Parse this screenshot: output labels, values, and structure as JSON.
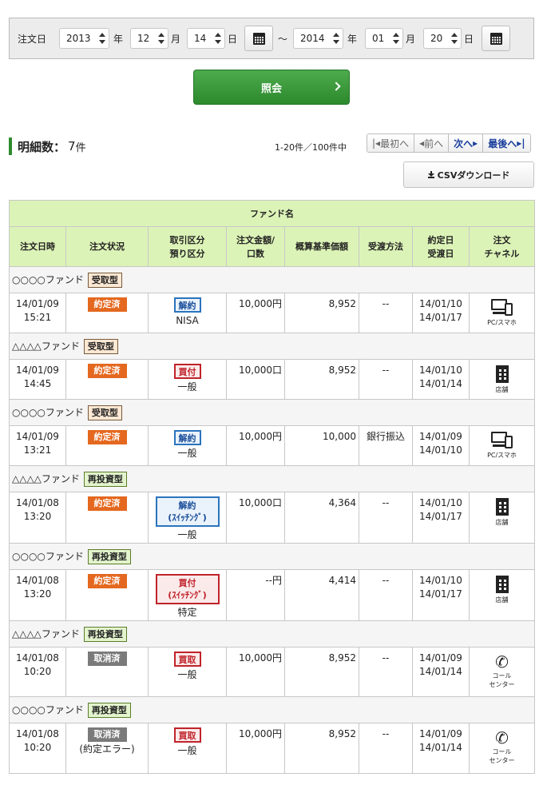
{
  "filter": {
    "label": "注文日",
    "from": {
      "year": "2013",
      "month": "12",
      "day": "14"
    },
    "to": {
      "year": "2014",
      "month": "01",
      "day": "20"
    },
    "year_unit": "年",
    "month_unit": "月",
    "day_unit": "日",
    "separator": "～"
  },
  "search_label": "照会",
  "count": {
    "label": "明細数：",
    "value": "7",
    "unit": "件"
  },
  "range_text": "1-20件／100件中",
  "pager": {
    "first": "最初へ",
    "prev": "前へ",
    "next": "次へ",
    "last": "最後へ"
  },
  "csv_label": "CSVダウンロード",
  "table": {
    "fund_header": "ファンド名",
    "headers": {
      "date": "注文日時",
      "status": "注文状況",
      "type_l1": "取引区分",
      "type_l2": "預り区分",
      "amount_l1": "注文金額/",
      "amount_l2": "口数",
      "price": "概算基準価額",
      "payment": "受渡方法",
      "dates_l1": "約定日",
      "dates_l2": "受渡日",
      "channel_l1": "注文",
      "channel_l2": "チャネル"
    },
    "orders": [
      {
        "fund": "○○○○ファンド",
        "fund_type": "受取型",
        "date": "14/01/09",
        "time": "15:21",
        "status": "約定済",
        "status_sub": "",
        "trade": "解約",
        "trade_sub": "",
        "account": "NISA",
        "amount": "10,000円",
        "price": "8,952",
        "payment": "--",
        "exec_date": "14/01/10",
        "settle_date": "14/01/17",
        "channel_l1": "PC/スマホ",
        "channel_l2": ""
      },
      {
        "fund": "△△△△ファンド",
        "fund_type": "受取型",
        "date": "14/01/09",
        "time": "14:45",
        "status": "約定済",
        "status_sub": "",
        "trade": "買付",
        "trade_sub": "",
        "account": "一般",
        "amount": "10,000口",
        "price": "8,952",
        "payment": "--",
        "exec_date": "14/01/10",
        "settle_date": "14/01/14",
        "channel_l1": "店舗",
        "channel_l2": ""
      },
      {
        "fund": "○○○○ファンド",
        "fund_type": "受取型",
        "date": "14/01/09",
        "time": "13:21",
        "status": "約定済",
        "status_sub": "",
        "trade": "解約",
        "trade_sub": "",
        "account": "一般",
        "amount": "10,000円",
        "price": "10,000",
        "payment": "銀行振込",
        "exec_date": "14/01/09",
        "settle_date": "14/01/10",
        "channel_l1": "PC/スマホ",
        "channel_l2": ""
      },
      {
        "fund": "△△△△ファンド",
        "fund_type": "再投資型",
        "date": "14/01/08",
        "time": "13:20",
        "status": "約定済",
        "status_sub": "",
        "trade": "解約",
        "trade_sub": "(ｽｲｯﾁﾝｸﾞ)",
        "account": "一般",
        "amount": "10,000口",
        "price": "4,364",
        "payment": "--",
        "exec_date": "14/01/10",
        "settle_date": "14/01/17",
        "channel_l1": "店舗",
        "channel_l2": ""
      },
      {
        "fund": "○○○○ファンド",
        "fund_type": "再投資型",
        "date": "14/01/08",
        "time": "13:20",
        "status": "約定済",
        "status_sub": "",
        "trade": "買付",
        "trade_sub": "(ｽｲｯﾁﾝｸﾞ)",
        "account": "特定",
        "amount": "--円",
        "price": "4,414",
        "payment": "--",
        "exec_date": "14/01/10",
        "settle_date": "14/01/17",
        "channel_l1": "店舗",
        "channel_l2": ""
      },
      {
        "fund": "△△△△ファンド",
        "fund_type": "再投資型",
        "date": "14/01/08",
        "time": "10:20",
        "status": "取消済",
        "status_sub": "",
        "trade": "買取",
        "trade_sub": "",
        "account": "一般",
        "amount": "10,000円",
        "price": "8,952",
        "payment": "--",
        "exec_date": "14/01/09",
        "settle_date": "14/01/14",
        "channel_l1": "コール",
        "channel_l2": "センター"
      },
      {
        "fund": "○○○○ファンド",
        "fund_type": "再投資型",
        "date": "14/01/08",
        "time": "10:20",
        "status": "取消済",
        "status_sub": "(約定エラー)",
        "trade": "買取",
        "trade_sub": "",
        "account": "一般",
        "amount": "10,000円",
        "price": "8,952",
        "payment": "--",
        "exec_date": "14/01/09",
        "settle_date": "14/01/14",
        "channel_l1": "コール",
        "channel_l2": "センター"
      }
    ]
  },
  "colors": {
    "accent_green": "#2e8b2e",
    "header_bg": "#dcf3b7",
    "status_done": "#e4681f",
    "status_cancel": "#7a7a7a"
  }
}
